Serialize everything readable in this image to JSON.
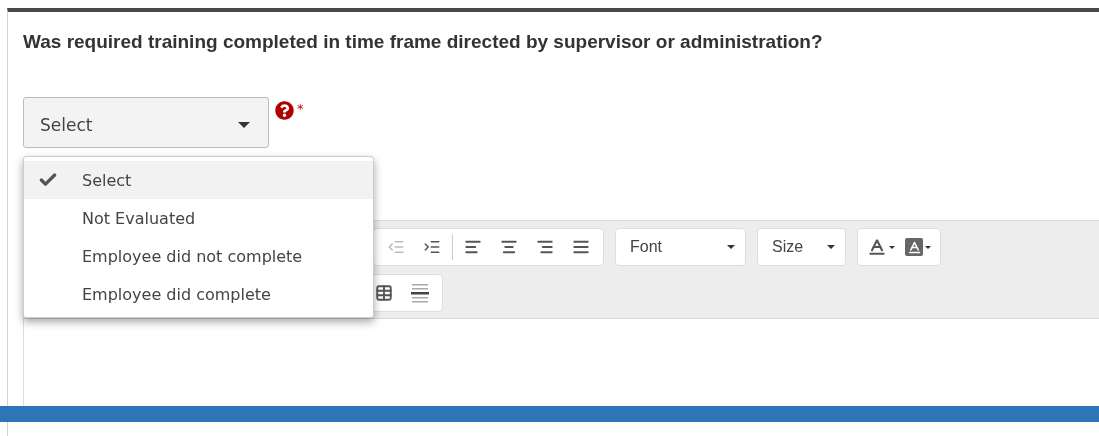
{
  "question": "Was required training completed in time frame directed by supervisor or administration?",
  "select": {
    "value": "Select",
    "required_mark": "*"
  },
  "options": [
    {
      "label": "Select",
      "selected": true
    },
    {
      "label": "Not Evaluated",
      "selected": false
    },
    {
      "label": "Employee did not complete",
      "selected": false
    },
    {
      "label": "Employee did complete",
      "selected": false
    }
  ],
  "toolbar": {
    "font": "Font",
    "size": "Size"
  }
}
